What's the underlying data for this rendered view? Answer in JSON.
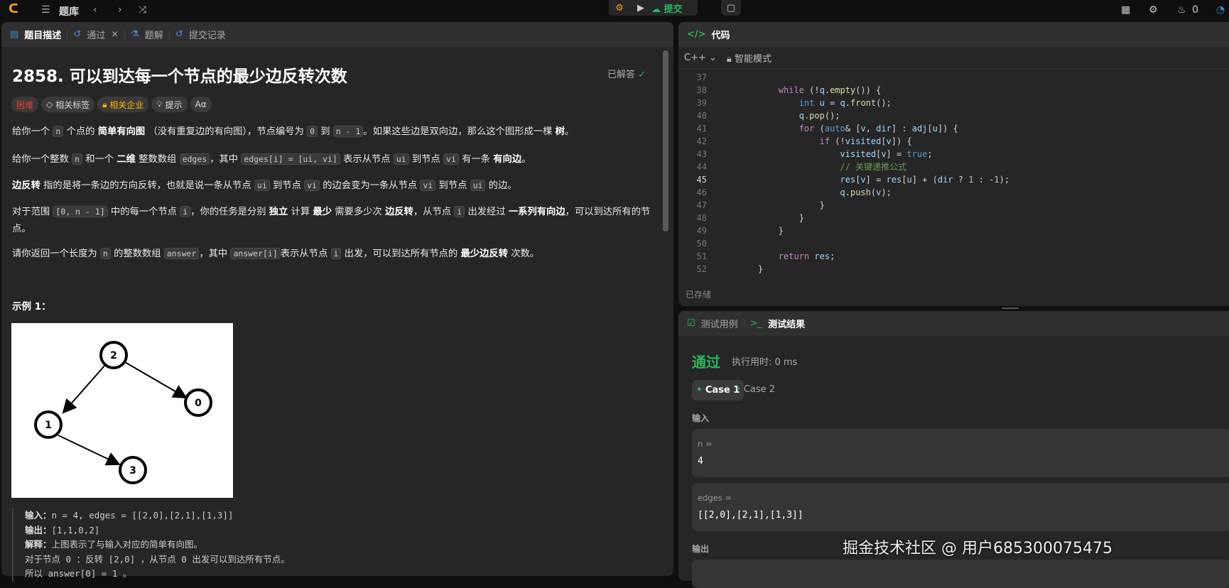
{
  "topbar": {
    "problem_bank": "题库",
    "submit": "提交",
    "fire_count": "0"
  },
  "left": {
    "tabs": [
      "题目描述",
      "通过",
      "题解",
      "提交记录"
    ],
    "title": "2858. 可以到达每一个节点的最少边反转次数",
    "solved": "已解答",
    "tags": {
      "difficulty": "困难",
      "related_tags": "相关标签",
      "companies": "相关企业",
      "hint": "提示",
      "font": "Aα"
    },
    "p1": {
      "a": "给你一个",
      "n": "n",
      "b": "个点的",
      "bold1": "简单有向图",
      "c": "（没有重复边的有向图），节点编号为",
      "zero": "0",
      "d": "到",
      "nm1": "n - 1",
      "e": "。如果这些边是双向边，那么这个图形成一棵",
      "bold2": "树",
      "f": "。"
    },
    "p2": {
      "a": "给你一个整数",
      "n": "n",
      "b": "和一个",
      "bold1": "二维",
      "c": "整数数组",
      "edges": "edges",
      "d": "，其中",
      "edgesi": "edges[i] = [ui, vi]",
      "e": "表示从节点",
      "ui": "ui",
      "f": "到节点",
      "vi": "vi",
      "g": "有一条",
      "bold2": "有向边",
      "h": "。"
    },
    "p3": {
      "bold1": "边反转",
      "a": "指的是将一条边的方向反转，也就是说一条从节点",
      "ui": "ui",
      "b": "到节点",
      "vi": "vi",
      "c": "的边会变为一条从节点",
      "vi2": "vi",
      "d": "到节点",
      "ui2": "ui",
      "e": "的边。"
    },
    "p4": {
      "a": "对于范围",
      "range": "[0, n - 1]",
      "b": "中的每一个节点",
      "i": "i",
      "c": "，你的任务是分别",
      "bold1": "独立",
      "d": "计算",
      "bold2": "最少",
      "e": "需要多少次",
      "bold3": "边反转",
      "f": "，从节点",
      "i2": "i",
      "g": "出发经过",
      "bold4": "一系列有向边",
      "h": "，可以到达所有的节点。"
    },
    "p5": {
      "a": "请你返回一个长度为",
      "n": "n",
      "b": "的整数数组",
      "answer": "answer",
      "c": "，其中",
      "answeri": "answer[i]",
      "d": "表示从节点",
      "i": "i",
      "e": "出发，可以到达所有节点的",
      "bold1": "最少边反转",
      "f": "次数。"
    },
    "example_title": "示例 1：",
    "graph_nodes": [
      "2",
      "0",
      "1",
      "3"
    ],
    "example": {
      "in_label": "输入：",
      "in": "n = 4, edges = [[2,0],[2,1],[1,3]]",
      "out_label": "输出：",
      "out": "[1,1,0,2]",
      "exp_label": "解释：",
      "exp": "上图表示了与输入对应的简单有向图。",
      "line4": "对于节点 0 ：反转 [2,0] ，从节点 0 出发可以到达所有节点。",
      "line5": "所以 answer[0] = 1 。"
    }
  },
  "editor": {
    "title": "代码",
    "language": "C++",
    "mode": "智能模式",
    "saved": "已存储",
    "lines": [
      {
        "n": "37",
        "t": []
      },
      {
        "n": "38",
        "t": [
          [
            "        ",
            "pl"
          ],
          [
            "while",
            "kw"
          ],
          [
            " (!",
            "pl"
          ],
          [
            "q",
            "va"
          ],
          [
            ".",
            "pl"
          ],
          [
            "empty",
            "fn"
          ],
          [
            "()) {",
            "pl"
          ]
        ]
      },
      {
        "n": "39",
        "t": [
          [
            "            ",
            "pl"
          ],
          [
            "int",
            "ty"
          ],
          [
            " ",
            "pl"
          ],
          [
            "u",
            "va"
          ],
          [
            " = ",
            "pl"
          ],
          [
            "q",
            "va"
          ],
          [
            ".",
            "pl"
          ],
          [
            "front",
            "fn"
          ],
          [
            "();",
            "pl"
          ]
        ]
      },
      {
        "n": "40",
        "t": [
          [
            "            ",
            "pl"
          ],
          [
            "q",
            "va"
          ],
          [
            ".",
            "pl"
          ],
          [
            "pop",
            "fn"
          ],
          [
            "();",
            "pl"
          ]
        ]
      },
      {
        "n": "41",
        "t": [
          [
            "            ",
            "pl"
          ],
          [
            "for",
            "kw"
          ],
          [
            " (",
            "pl"
          ],
          [
            "auto",
            "ty"
          ],
          [
            "& [",
            "pl"
          ],
          [
            "v",
            "va"
          ],
          [
            ", ",
            "pl"
          ],
          [
            "dir",
            "va"
          ],
          [
            "] : ",
            "pl"
          ],
          [
            "adj",
            "va"
          ],
          [
            "[",
            "pl"
          ],
          [
            "u",
            "va"
          ],
          [
            "]) {",
            "pl"
          ]
        ]
      },
      {
        "n": "42",
        "t": [
          [
            "                ",
            "pl"
          ],
          [
            "if",
            "kw"
          ],
          [
            " (!",
            "pl"
          ],
          [
            "visited",
            "va"
          ],
          [
            "[",
            "pl"
          ],
          [
            "v",
            "va"
          ],
          [
            "]) {",
            "pl"
          ]
        ]
      },
      {
        "n": "43",
        "t": [
          [
            "                    ",
            "pl"
          ],
          [
            "visited",
            "va"
          ],
          [
            "[",
            "pl"
          ],
          [
            "v",
            "va"
          ],
          [
            "] = ",
            "pl"
          ],
          [
            "true",
            "ty"
          ],
          [
            ";",
            "pl"
          ]
        ]
      },
      {
        "n": "44",
        "t": [
          [
            "                    ",
            "pl"
          ],
          [
            "// 关键递推公式",
            "cm"
          ]
        ]
      },
      {
        "n": "45",
        "t": [
          [
            "                    ",
            "pl"
          ],
          [
            "res",
            "va"
          ],
          [
            "[",
            "pl"
          ],
          [
            "v",
            "va"
          ],
          [
            "] = ",
            "pl"
          ],
          [
            "res",
            "va"
          ],
          [
            "[",
            "pl"
          ],
          [
            "u",
            "va"
          ],
          [
            "] + (",
            "pl"
          ],
          [
            "dir",
            "va"
          ],
          [
            " ? ",
            "pl"
          ],
          [
            "1",
            "nu"
          ],
          [
            " : -",
            "pl"
          ],
          [
            "1",
            "nu"
          ],
          [
            ");",
            "pl"
          ]
        ]
      },
      {
        "n": "46",
        "t": [
          [
            "                    ",
            "pl"
          ],
          [
            "q",
            "va"
          ],
          [
            ".",
            "pl"
          ],
          [
            "push",
            "fn"
          ],
          [
            "(",
            "pl"
          ],
          [
            "v",
            "va"
          ],
          [
            ");",
            "pl"
          ]
        ]
      },
      {
        "n": "47",
        "t": [
          [
            "                ",
            "pl"
          ],
          [
            "}",
            "pl"
          ]
        ]
      },
      {
        "n": "48",
        "t": [
          [
            "            ",
            "pl"
          ],
          [
            "}",
            "pl"
          ]
        ]
      },
      {
        "n": "49",
        "t": [
          [
            "        ",
            "pl"
          ],
          [
            "}",
            "pl"
          ]
        ]
      },
      {
        "n": "50",
        "t": []
      },
      {
        "n": "51",
        "t": [
          [
            "        ",
            "pl"
          ],
          [
            "return",
            "kw"
          ],
          [
            " ",
            "pl"
          ],
          [
            "res",
            "va"
          ],
          [
            ";",
            "pl"
          ]
        ]
      },
      {
        "n": "52",
        "t": [
          [
            "    ",
            "pl"
          ],
          [
            "}",
            "pl"
          ]
        ]
      }
    ]
  },
  "results": {
    "tabs": [
      "测试用例",
      "测试结果"
    ],
    "status": "通过",
    "runtime": "执行用时: 0 ms",
    "cases": [
      "Case 1",
      "Case 2"
    ],
    "input_label": "输入",
    "inputs": [
      {
        "name": "n =",
        "value": "4"
      },
      {
        "name": "edges =",
        "value": "[[2,0],[2,1],[1,3]]"
      }
    ],
    "output_label": "输出"
  },
  "watermark": "掘金技术社区 @ 用户685300075475",
  "colors": {
    "green": "#2db55d",
    "hard": "#f63636",
    "company": "#ffb800",
    "blue": "#3c8dde"
  }
}
